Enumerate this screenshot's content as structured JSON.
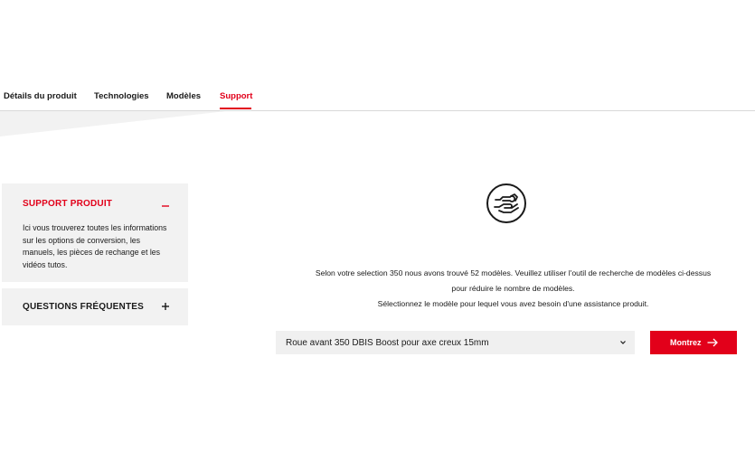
{
  "tabs": [
    {
      "label": "Détails du produit"
    },
    {
      "label": "Technologies"
    },
    {
      "label": "Modèles"
    },
    {
      "label": "Support",
      "active": true
    }
  ],
  "accordion": {
    "support": {
      "title": "SUPPORT PRODUIT",
      "expanded": true,
      "text": "Ici vous trouverez toutes les informations sur les options de conversion, les manuels, les pièces de rechange et les vidéos tutos."
    },
    "faq": {
      "title": "QUESTIONS FRÉQUENTES",
      "expanded": false
    }
  },
  "support_tool": {
    "icon": "hand-wrench-icon",
    "info_line1": "Selon votre selection 350 nous avons trouvé 52 modèles. Veuillez utiliser l'outil de recherche de modèles ci-dessus",
    "info_line2": "pour réduire le nombre de modèles.",
    "info_line3": "Sélectionnez le modèle pour lequel vous avez besoin d'une assistance produit.",
    "select_value": "Roue avant 350 DBIS Boost pour axe creux 15mm",
    "button_label": "Montrez"
  },
  "colors": {
    "accent": "#e2001a",
    "panel": "#f2f2f2",
    "select_bg": "#f0f0f0"
  }
}
